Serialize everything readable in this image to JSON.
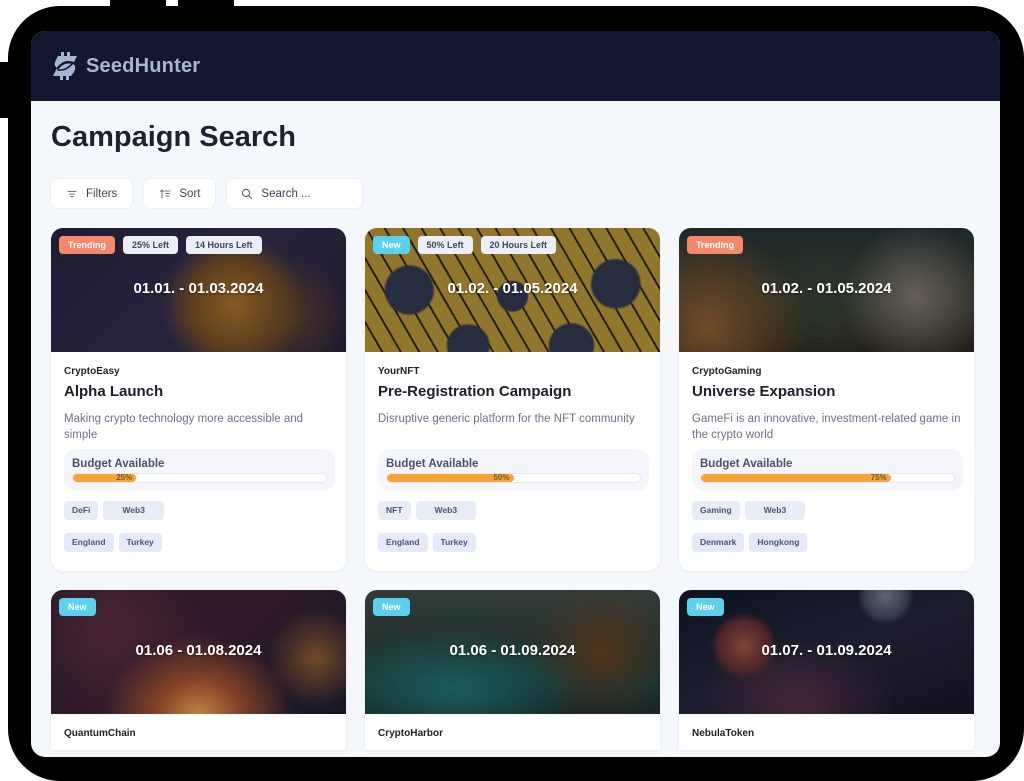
{
  "app": {
    "name": "SeedHunter"
  },
  "page": {
    "title": "Campaign Search"
  },
  "toolbar": {
    "filters_label": "Filters",
    "sort_label": "Sort",
    "search_placeholder": "Search ..."
  },
  "budget_label": "Budget Available",
  "campaigns": [
    {
      "badges": [
        {
          "label": "Trending",
          "type": "trending"
        },
        {
          "label": "25% Left",
          "type": "info"
        },
        {
          "label": "14 Hours Left",
          "type": "info"
        }
      ],
      "dates": "01.01. - 01.03.2024",
      "company": "CryptoEasy",
      "title": "Alpha Launch",
      "description": "Making crypto technology more accessible and simple",
      "budget_percent": 25,
      "budget_text": "25%",
      "categories": [
        "DeFi",
        "Web3"
      ],
      "regions": [
        "England",
        "Turkey"
      ]
    },
    {
      "badges": [
        {
          "label": "New",
          "type": "new"
        },
        {
          "label": "50% Left",
          "type": "info"
        },
        {
          "label": "20 Hours Left",
          "type": "info"
        }
      ],
      "dates": "01.02. - 01.05.2024",
      "company": "YourNFT",
      "title": "Pre-Registration Campaign",
      "description": "Disruptive generic platform for the NFT community",
      "budget_percent": 50,
      "budget_text": "50%",
      "categories": [
        "NFT",
        "Web3"
      ],
      "regions": [
        "England",
        "Turkey"
      ]
    },
    {
      "badges": [
        {
          "label": "Trending",
          "type": "trending"
        }
      ],
      "dates": "01.02. - 01.05.2024",
      "company": "CryptoGaming",
      "title": "Universe Expansion",
      "description": "GameFi is an innovative, investment-related game in the crypto world",
      "budget_percent": 75,
      "budget_text": "75%",
      "categories": [
        "Gaming",
        "Web3"
      ],
      "regions": [
        "Denmark",
        "Hongkong"
      ]
    },
    {
      "badges": [
        {
          "label": "New",
          "type": "new"
        }
      ],
      "dates": "01.06 - 01.08.2024",
      "company": "QuantumChain"
    },
    {
      "badges": [
        {
          "label": "New",
          "type": "new"
        }
      ],
      "dates": "01.06 - 01.09.2024",
      "company": "CryptoHarbor"
    },
    {
      "badges": [
        {
          "label": "New",
          "type": "new"
        }
      ],
      "dates": "01.07. - 01.09.2024",
      "company": "NebulaToken"
    }
  ],
  "colors": {
    "topbar": "#12162e",
    "trending": "#f5876a",
    "new": "#5cd1ee",
    "budget_bar": "#f7a338"
  }
}
